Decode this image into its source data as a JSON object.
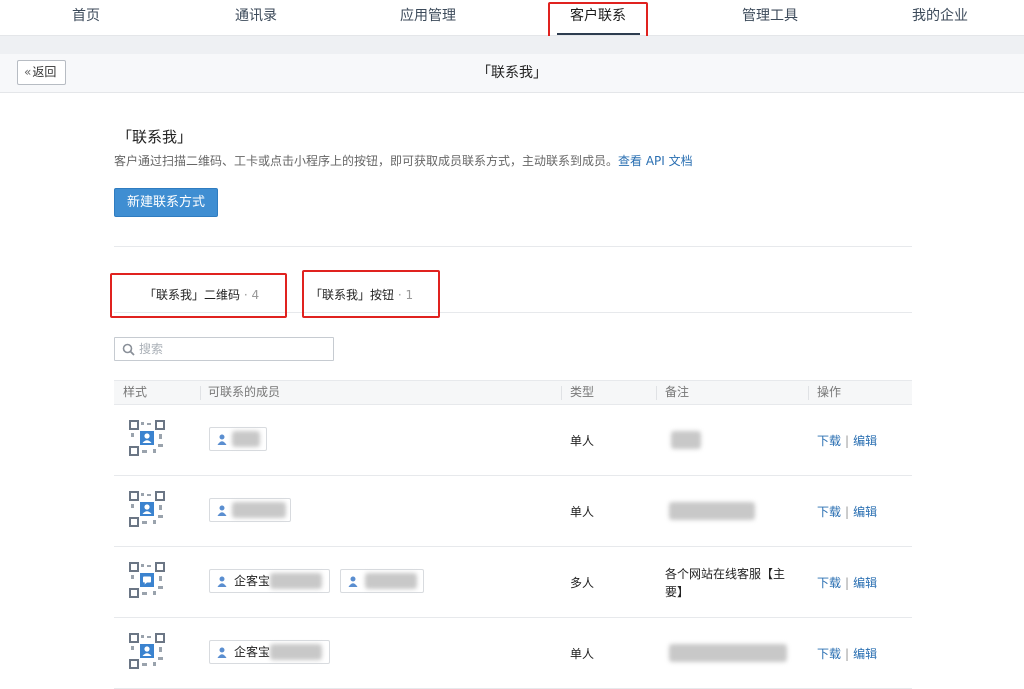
{
  "nav": {
    "items": [
      "首页",
      "通讯录",
      "应用管理",
      "客户联系",
      "管理工具",
      "我的企业"
    ],
    "active": "客户联系"
  },
  "titlebar": {
    "back_label": "返回",
    "title": "「联系我」"
  },
  "intro": {
    "title": "「联系我」",
    "desc": "客户通过扫描二维码、工卡或点击小程序上的按钮，即可获取成员联系方式，主动联系到成员。",
    "api_link": "查看 API 文档",
    "new_button": "新建联系方式"
  },
  "tabs": [
    {
      "label": "「联系我」二维码",
      "count": "· 4"
    },
    {
      "label": "「联系我」按钮",
      "count": "· 1"
    }
  ],
  "search": {
    "placeholder": "搜索"
  },
  "table": {
    "headers": [
      "样式",
      "可联系的成员",
      "类型",
      "备注",
      "操作"
    ],
    "rows": [
      {
        "member1": "",
        "member2": null,
        "type": "单人",
        "remark": "",
        "download": "下载",
        "edit": "编辑"
      },
      {
        "member1": "",
        "member2": null,
        "type": "单人",
        "remark": "",
        "download": "下载",
        "edit": "编辑"
      },
      {
        "member1": "企客宝",
        "member2": "",
        "type": "多人",
        "remark": "各个网站在线客服【主要】",
        "download": "下载",
        "edit": "编辑"
      },
      {
        "member1": "企客宝",
        "member2": null,
        "type": "单人",
        "remark": "",
        "download": "下载",
        "edit": "编辑"
      }
    ]
  },
  "colors": {
    "accent": "#3f8ed2",
    "link": "#2a6fb2",
    "highlight": "#e0221f"
  }
}
